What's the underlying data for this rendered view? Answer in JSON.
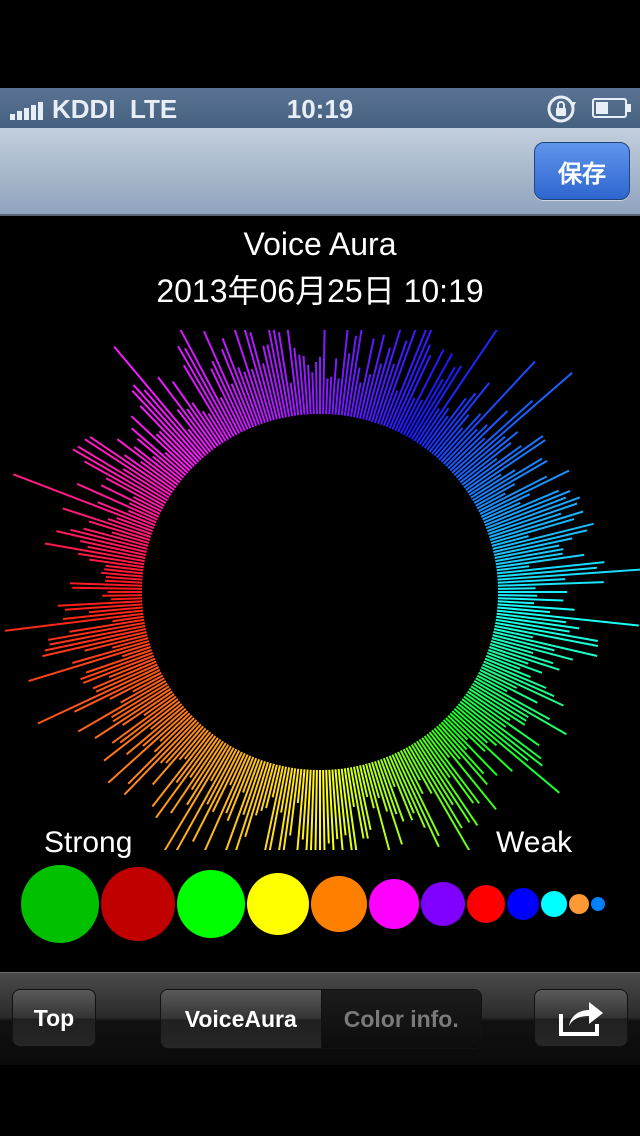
{
  "status_bar": {
    "carrier": "KDDI",
    "network": "LTE",
    "time": "10:19"
  },
  "nav": {
    "save_label": "保存"
  },
  "header": {
    "title": "Voice Aura",
    "datetime": "2013年06月25日 10:19"
  },
  "legend": {
    "strong_label": "Strong",
    "weak_label": "Weak",
    "colors": [
      "#00c000",
      "#c00000",
      "#00ff00",
      "#ffff00",
      "#ff8000",
      "#ff00ff",
      "#8000ff",
      "#ff0000",
      "#0000ff",
      "#00ffff",
      "#ff9933",
      "#0080ff"
    ]
  },
  "aura": {
    "hue_sequence": [
      "cyan",
      "green",
      "yellow",
      "orange",
      "red",
      "magenta",
      "purple",
      "blue"
    ]
  },
  "toolbar": {
    "top_label": "Top",
    "tab_voiceaura": "VoiceAura",
    "tab_colorinfo": "Color info.",
    "selected_tab": "VoiceAura"
  }
}
